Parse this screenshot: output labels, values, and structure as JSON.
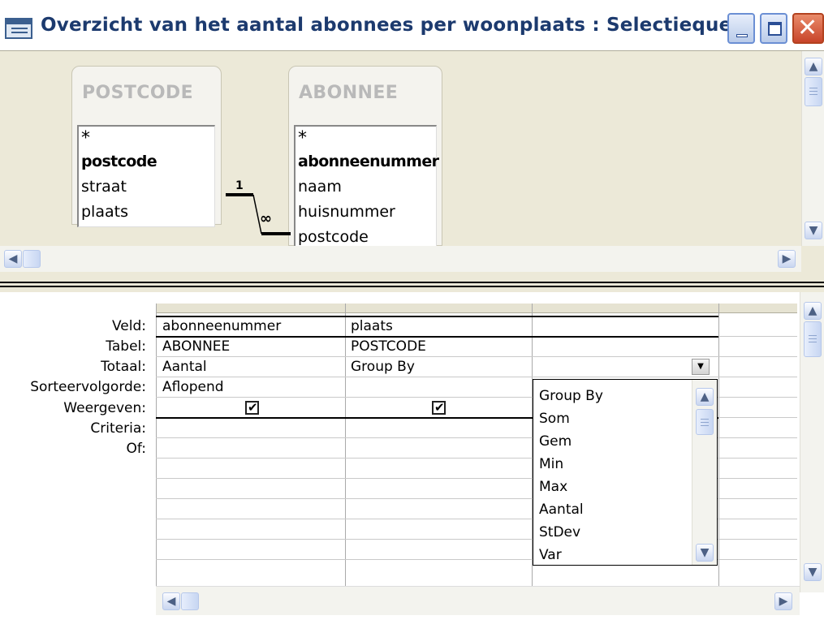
{
  "window": {
    "title": "Overzicht van het aantal abonnees per woonplaats : Selectiequery"
  },
  "upper": {
    "tables": [
      {
        "name": "POSTCODE",
        "fields": [
          {
            "label": "*"
          },
          {
            "label": "postcode",
            "primary_key": true
          },
          {
            "label": "straat"
          },
          {
            "label": "plaats"
          }
        ]
      },
      {
        "name": "ABONNEE",
        "fields": [
          {
            "label": "*"
          },
          {
            "label": "abonneenummer",
            "primary_key": true
          },
          {
            "label": "naam"
          },
          {
            "label": "huisnummer"
          },
          {
            "label": "postcode"
          }
        ]
      }
    ],
    "relationship": {
      "one_side": "1",
      "many_side": "∞"
    }
  },
  "grid": {
    "row_labels": [
      "Veld:",
      "Tabel:",
      "Totaal:",
      "Sorteervolgorde:",
      "Weergeven:",
      "Criteria:",
      "Of:"
    ],
    "columns": [
      {
        "veld": "abonneenummer",
        "tabel": "ABONNEE",
        "totaal": "Aantal",
        "sorteervolgorde": "Aflopend",
        "weergeven": true
      },
      {
        "veld": "plaats",
        "tabel": "POSTCODE",
        "totaal": "Group By",
        "sorteervolgorde": "",
        "weergeven": true
      },
      {
        "veld": "",
        "tabel": "",
        "totaal": "",
        "sorteervolgorde": "",
        "weergeven": false
      }
    ]
  },
  "dropdown": {
    "options": [
      "Group By",
      "Som",
      "Gem",
      "Min",
      "Max",
      "Aantal",
      "StDev",
      "Var"
    ]
  },
  "icons": {
    "window_icon": "query-window-icon",
    "checkmark": "✔"
  }
}
